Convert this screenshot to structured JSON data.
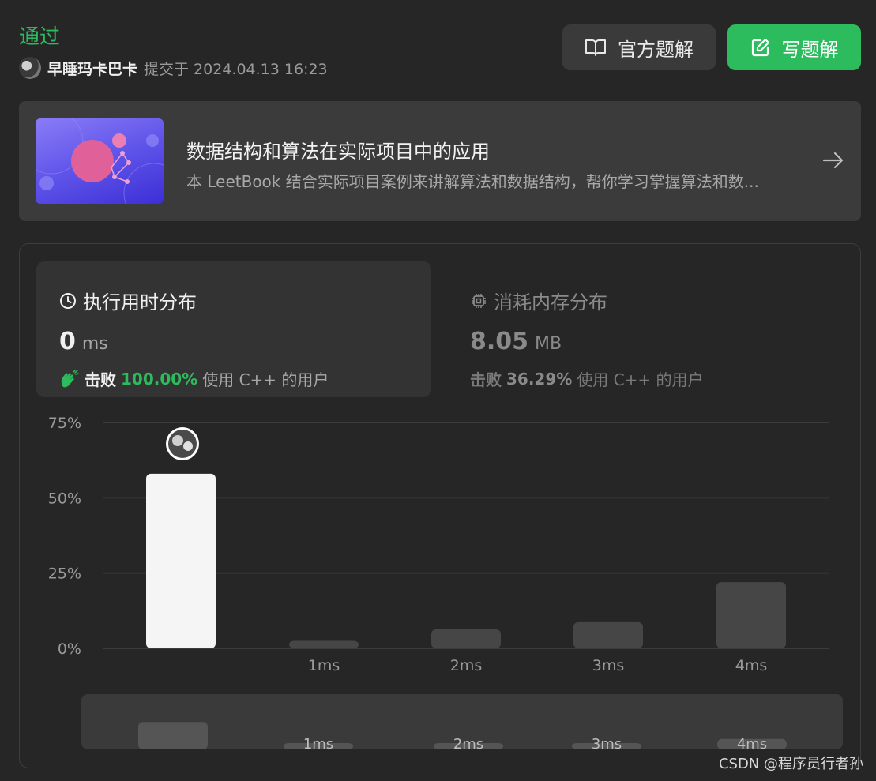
{
  "header": {
    "status": "通过",
    "username": "早睡玛卡巴卡",
    "submitted": "提交于 2024.04.13 16:23",
    "buttons": {
      "official_solution": "官方题解",
      "write_solution": "写题解"
    }
  },
  "book": {
    "title": "数据结构和算法在实际项目中的应用",
    "description": "本 LeetBook 结合实际项目案例来讲解算法和数据结构，帮你学习掌握算法和数..."
  },
  "tabs": {
    "time": {
      "title": "执行用时分布",
      "value": "0",
      "unit": "ms",
      "beat_word": "击败",
      "beat_pct": "100.00%",
      "beat_suffix": "使用 C++ 的用户"
    },
    "memory": {
      "title": "消耗内存分布",
      "value": "8.05",
      "unit": "MB",
      "beat_word": "击败",
      "beat_pct": "36.29%",
      "beat_suffix": "使用 C++ 的用户"
    }
  },
  "chart_data": {
    "type": "bar",
    "categories": [
      "0ms",
      "1ms",
      "2ms",
      "3ms",
      "4ms"
    ],
    "category_labels": [
      "",
      "1ms",
      "2ms",
      "3ms",
      "4ms"
    ],
    "values": [
      58,
      2.5,
      6.3,
      8.7,
      22
    ],
    "ylim": [
      0,
      75
    ],
    "yticks": [
      0,
      25,
      50,
      75
    ],
    "ytick_labels": [
      "0%",
      "25%",
      "50%",
      "75%"
    ],
    "highlight_index": 0,
    "colors": {
      "highlight": "#f5f5f5",
      "bar": "#464646",
      "grid": "#444444",
      "tick": "#9a9a9a"
    },
    "overview_labels": [
      "1ms",
      "2ms",
      "3ms",
      "4ms"
    ]
  },
  "watermark": "CSDN @程序员行者孙",
  "colors": {
    "accent": "#2cbb5d",
    "background": "#262626",
    "card": "#3b3b3b"
  }
}
